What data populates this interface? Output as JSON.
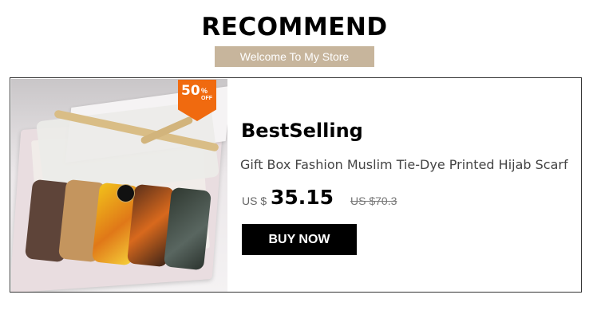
{
  "header": {
    "title": "RECOMMEND",
    "subtitle": "Welcome To My Store"
  },
  "product": {
    "badge": {
      "value": "50",
      "percent": "%",
      "off": "OFF"
    },
    "title": "BestSelling",
    "description": "Gift Box Fashion Muslim Tie-Dye Printed Hijab Scarf",
    "price_prefix": "US $",
    "price": "35.15",
    "original_price": "US $70.3",
    "buy_label": "BUY NOW"
  },
  "colors": {
    "accent_banner": "#c7b59c",
    "discount_badge": "#f06a0f",
    "button": "#000000"
  }
}
